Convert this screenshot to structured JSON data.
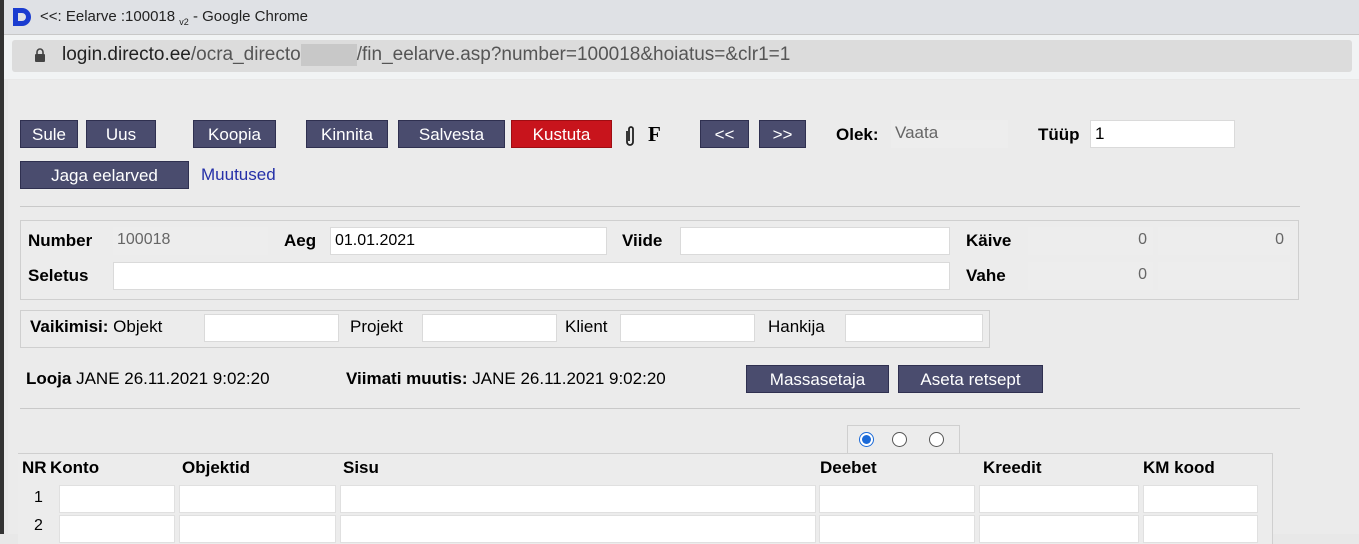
{
  "window": {
    "title_prefix": "<<: Eelarve :100018",
    "title_sub": "v2",
    "title_suffix": " - Google Chrome"
  },
  "address": {
    "host": "login.directo.ee",
    "path_a": "/ocra_directo",
    "path_b": "/fin_eelarve.asp?number=100018&hoiatus=&clr1=1"
  },
  "toolbar": {
    "sule": "Sule",
    "uus": "Uus",
    "koopia": "Koopia",
    "kinnita": "Kinnita",
    "salvesta": "Salvesta",
    "kustuta": "Kustuta",
    "f_label": "F",
    "prev": "<<",
    "next": ">>",
    "olek_label": "Olek:",
    "olek_value": "Vaata",
    "tyyp_label": "Tüüp",
    "tyyp_value": "1",
    "jaga": "Jaga eelarved",
    "muutused": "Muutused"
  },
  "header": {
    "number_label": "Number",
    "number_value": "100018",
    "aeg_label": "Aeg",
    "aeg_value": "01.01.2021",
    "viide_label": "Viide",
    "viide_value": "",
    "kaive_label": "Käive",
    "kaive_1": "0",
    "kaive_2": "0",
    "seletus_label": "Seletus",
    "seletus_value": "",
    "vahe_label": "Vahe",
    "vahe_1": "0",
    "vahe_2": ""
  },
  "defaults": {
    "label": "Vaikimisi:",
    "objekt": "Objekt",
    "projekt": "Projekt",
    "klient": "Klient",
    "hankija": "Hankija"
  },
  "audit": {
    "looja_label": "Looja",
    "looja_value": "JANE 26.11.2021 9:02:20",
    "viimati_label": "Viimati muutis:",
    "viimati_value": "JANE 26.11.2021 9:02:20",
    "massasetaja": "Massasetaja",
    "aseta": "Aseta retsept"
  },
  "table": {
    "headers": [
      "NR",
      "Konto",
      "Objektid",
      "Sisu",
      "Deebet",
      "Kreedit",
      "KM kood"
    ],
    "rows": [
      "1",
      "2"
    ]
  },
  "colors": {
    "button": "#4a4c6e",
    "danger": "#c8141c",
    "link": "#2530a8"
  }
}
